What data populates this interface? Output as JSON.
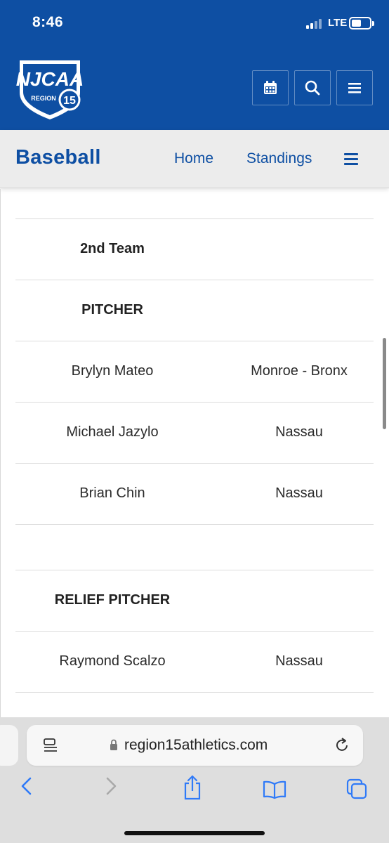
{
  "status_bar": {
    "time": "8:46",
    "network": "LTE",
    "battery_level": 0.45
  },
  "header": {
    "logo_text": "NJCAA",
    "logo_subtext": "REGION",
    "logo_number": "15",
    "buttons": [
      {
        "icon": "calendar-icon"
      },
      {
        "icon": "search-icon"
      },
      {
        "icon": "menu-icon"
      }
    ],
    "brand_color": "#0e4fa3"
  },
  "subnav": {
    "title": "Baseball",
    "links": [
      "Home",
      "Standings"
    ],
    "menu_icon": "menu-icon"
  },
  "roster": {
    "rows": [
      {
        "left": "",
        "right": "",
        "bold": false
      },
      {
        "left": "2nd Team",
        "right": "",
        "bold": true
      },
      {
        "left": "PITCHER",
        "right": "",
        "bold": true
      },
      {
        "left": "Brylyn Mateo",
        "right": "Monroe - Bronx",
        "bold": false
      },
      {
        "left": "Michael Jazylo",
        "right": "Nassau",
        "bold": false
      },
      {
        "left": "Brian Chin",
        "right": "Nassau",
        "bold": false
      },
      {
        "left": "",
        "right": "",
        "bold": false
      },
      {
        "left": "RELIEF PITCHER",
        "right": "",
        "bold": true
      },
      {
        "left": "Raymond Scalzo",
        "right": "Nassau",
        "bold": false
      },
      {
        "left": "",
        "right": "",
        "bold": false
      }
    ]
  },
  "browser": {
    "url": "region15athletics.com",
    "toolbar": [
      "back-icon",
      "forward-icon",
      "share-icon",
      "bookmarks-icon",
      "tabs-icon"
    ]
  }
}
